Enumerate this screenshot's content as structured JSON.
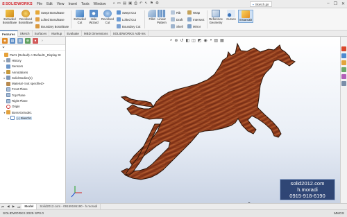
{
  "app": {
    "logo_text": "SOLIDWORKS",
    "doc_title": "Sketch.jpr"
  },
  "menu": [
    "File",
    "Edit",
    "View",
    "Insert",
    "Tools",
    "Window"
  ],
  "toolbar": {
    "extruded_boss": "Extruded Boss/Base",
    "revolved_boss": "Revolved Boss/Base",
    "swept_boss": "Swept Boss/Base",
    "lofted_boss": "Lofted Boss/Base",
    "boundary_boss": "Boundary Boss/Base",
    "extruded_cut": "Extruded Cut",
    "hole_wizard": "Hole Wizard",
    "revolved_cut": "Revolved Cut",
    "swept_cut": "Swept Cut",
    "lofted_cut": "Lofted Cut",
    "boundary_cut": "Boundary Cut",
    "fillet": "Fillet",
    "linear_pattern": "Linear Pattern",
    "rib": "Rib",
    "draft": "Draft",
    "shell": "Shell",
    "wrap": "Wrap",
    "intersect": "Intersect",
    "mirror": "Mirror",
    "reference_geometry": "Reference Geometry",
    "curves": "Curves",
    "instant3d": "Instant3D"
  },
  "tabs": [
    "Features",
    "Sketch",
    "Surfaces",
    "Markup",
    "Evaluate",
    "MBD Dimensions",
    "SOLIDWORKS Add-Ins"
  ],
  "tree": {
    "items": [
      {
        "label": "Part1 (Default) <<Default>_Display St",
        "arrow": ""
      },
      {
        "label": "History",
        "arrow": "▸"
      },
      {
        "label": "Sensors",
        "arrow": ""
      },
      {
        "label": "Annotations",
        "arrow": "▸"
      },
      {
        "label": "Solid Bodies(1)",
        "arrow": "▸"
      },
      {
        "label": "Material <not specified>",
        "arrow": ""
      },
      {
        "label": "Front Plane",
        "arrow": ""
      },
      {
        "label": "Top Plane",
        "arrow": ""
      },
      {
        "label": "Right Plane",
        "arrow": ""
      },
      {
        "label": "Origin",
        "arrow": ""
      },
      {
        "label": "Boss-Extrude1",
        "arrow": "▾"
      },
      {
        "label": "(-) Sketch1",
        "arrow": "▸"
      }
    ]
  },
  "bottom_tabs": [
    "Model",
    "Solid2012.com - 09159186190 - h.moradi"
  ],
  "status": {
    "left": "SOLIDWORKS 2025 SP0.0",
    "units": "MMGS"
  },
  "watermark": {
    "line1": "solid2012.com",
    "line2": "h.moradi",
    "line3": "0915-918-6190"
  },
  "colors": {
    "accent": "#2e6bb8",
    "brand": "#d2232a",
    "wood": "#8b3a1e"
  }
}
